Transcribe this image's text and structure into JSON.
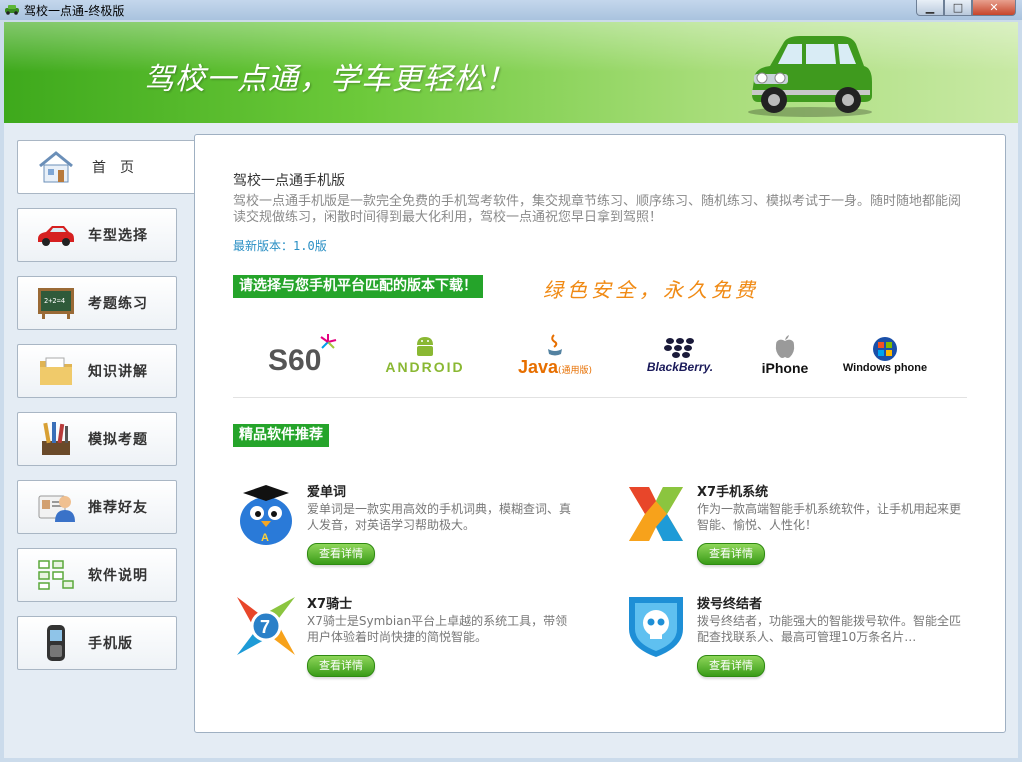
{
  "window": {
    "title": "驾校一点通-终极版",
    "buttons": {
      "minimize": "▁",
      "maximize": "□",
      "close": "✕"
    }
  },
  "banner": {
    "slogan": "驾校一点通，学车更轻松！"
  },
  "nav": {
    "items": [
      {
        "label": "首页",
        "icon": "house-icon"
      },
      {
        "label": "车型选择",
        "icon": "car-icon"
      },
      {
        "label": "考题练习",
        "icon": "blackboard-icon"
      },
      {
        "label": "知识讲解",
        "icon": "folder-icon"
      },
      {
        "label": "模拟考题",
        "icon": "pencils-icon"
      },
      {
        "label": "推荐好友",
        "icon": "contact-card-icon"
      },
      {
        "label": "软件说明",
        "icon": "flowchart-icon"
      },
      {
        "label": "手机版",
        "icon": "mobile-phone-icon"
      }
    ]
  },
  "main": {
    "title": "驾校一点通手机版",
    "description": "驾校一点通手机版是一款完全免费的手机驾考软件，集交规章节练习、顺序练习、随机练习、模拟考试于一身。随时随地都能阅读交规做练习，闲散时间得到最大化利用，驾校一点通祝您早日拿到驾照！",
    "version_label": "最新版本：",
    "version_value": "1.0版",
    "download_label": "请选择与您手机平台匹配的版本下载！",
    "download_slogan": "绿色安全，永久免费",
    "platforms": [
      {
        "name": "S60"
      },
      {
        "name": "ANDROID"
      },
      {
        "name": "Java",
        "note": "(通用版)"
      },
      {
        "name": "BlackBerry."
      },
      {
        "name": "iPhone"
      },
      {
        "name": "Windows phone"
      }
    ],
    "recommend_label": "精品软件推荐",
    "apps": [
      {
        "name": "爱单词",
        "desc": "爱单词是一款实用高效的手机词典，模糊查词、真人发音，对英语学习帮助极大。",
        "button": "查看详情"
      },
      {
        "name": "X7手机系统",
        "desc": "作为一款高端智能手机系统软件，让手机用起来更智能、愉悦、人性化！",
        "button": "查看详情"
      },
      {
        "name": "X7骑士",
        "desc": "X7骑士是Symbian平台上卓越的系统工具，带领用户体验着时尚快捷的简悦智能。",
        "button": "查看详情"
      },
      {
        "name": "拨号终结者",
        "desc": "拨号终结者，功能强大的智能拨号软件。智能全匹配查找联系人、最高可管理10万条名片…",
        "button": "查看详情"
      }
    ]
  },
  "colors": {
    "accent_green": "#25a42a",
    "slogan_orange": "#f08a14",
    "version_blue": "#2a8fc4"
  }
}
